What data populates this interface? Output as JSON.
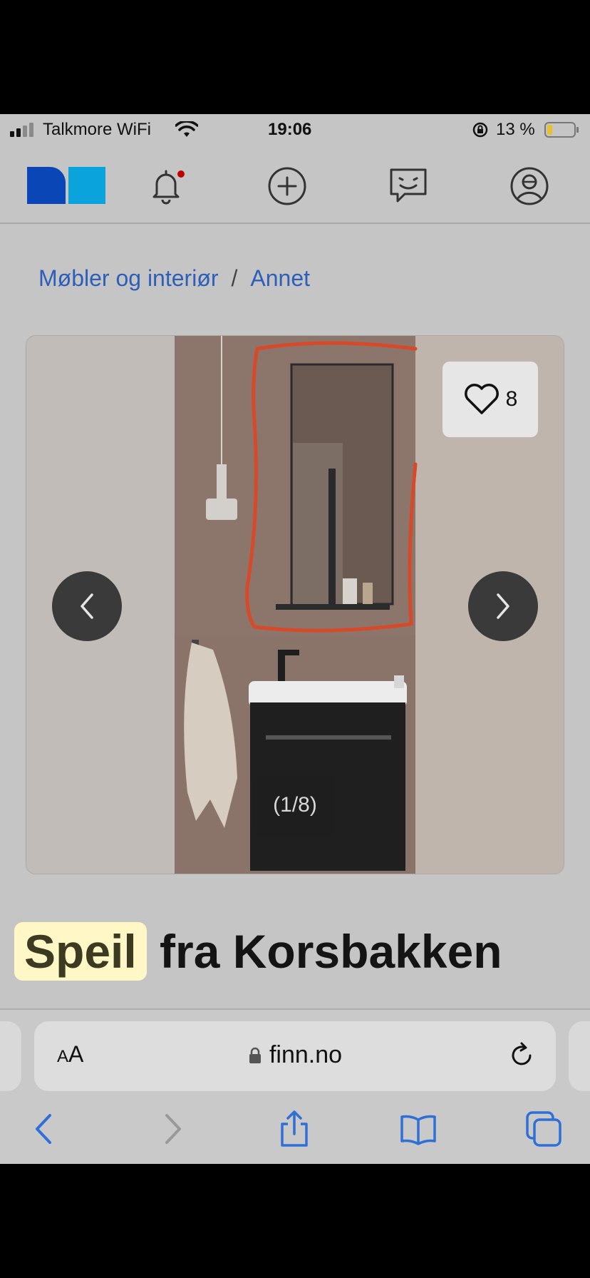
{
  "status_bar": {
    "carrier": "Talkmore WiFi",
    "time": "19:06",
    "battery_percent": "13 %"
  },
  "header": {
    "icons": [
      "finn-logo",
      "bell-icon",
      "plus-circle-icon",
      "chat-icon",
      "profile-icon"
    ],
    "has_notification_dot": true
  },
  "breadcrumb": {
    "category": "Møbler og interiør",
    "separator": "/",
    "subcategory": "Annet"
  },
  "gallery": {
    "favorite_count": "8",
    "counter": "(1/8)"
  },
  "listing": {
    "title_highlight": "Speil",
    "title_rest": " fra Korsbakken"
  },
  "browser": {
    "text_size_label_small": "A",
    "text_size_label_large": "A",
    "host": "finn.no"
  },
  "colors": {
    "link": "#2d5fb8",
    "logo_dark": "#0a46b5",
    "logo_light": "#0ba3dc",
    "notification_dot": "#c00000",
    "ios_blue": "#2f6fd6",
    "highlight": "#fff8c6"
  }
}
